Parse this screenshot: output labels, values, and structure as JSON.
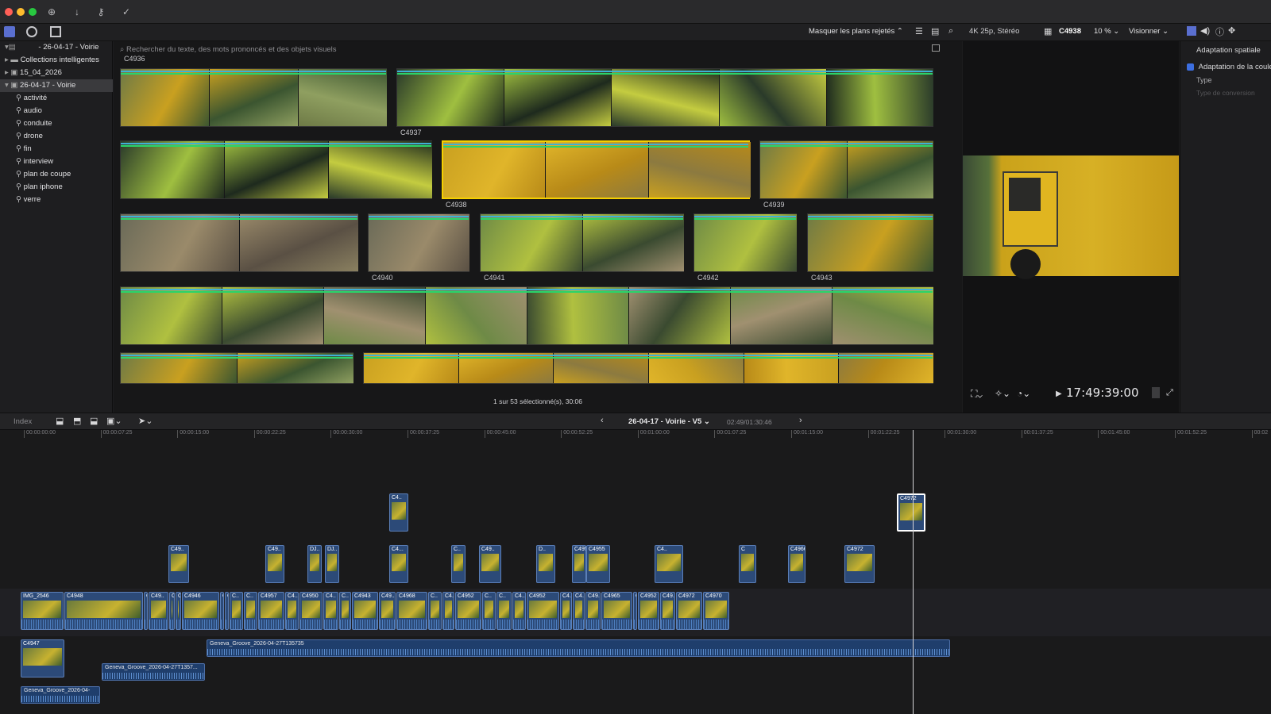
{
  "toolbar": {
    "library_title": "- 26-04-17 - Voirie",
    "hide_rejected": "Masquer les plans rejetés",
    "format": "4K 25p, Stéréo",
    "clip_name": "C4938",
    "zoom": "10 %",
    "view_menu": "Visionner"
  },
  "sidebar": {
    "items": [
      {
        "label": "Collections intelligentes"
      },
      {
        "label": "15_04_2026"
      },
      {
        "label": "26-04-17 - Voirie"
      }
    ],
    "keywords": [
      "activité",
      "audio",
      "conduite",
      "drone",
      "fin",
      "interview",
      "plan de coupe",
      "plan iphone",
      "verre"
    ]
  },
  "browser": {
    "search_placeholder": "Rechercher du texte, des mots prononcés et des objets visuels",
    "top_label": "C4936",
    "clip_labels": [
      "C4937",
      "C4938",
      "C4939",
      "C4940",
      "C4941",
      "C4942",
      "C4943"
    ],
    "status": "1 sur 53 sélectionné(s), 30:06"
  },
  "viewer": {
    "timecode": "17:49:39:00"
  },
  "inspector": {
    "title": "Adaptation spatiale",
    "checkbox_label": "Adaptation de la couleur",
    "type_label": "Type",
    "conversion_placeholder": "Type de conversion"
  },
  "timeline": {
    "index": "Index",
    "project": "26-04-17 - Voirie - V5",
    "duration": "02:49/01:30:46",
    "ruler": [
      "00:00:00:00",
      "00:00:07:25",
      "00:00:15:00",
      "00:00:22:25",
      "00:00:30:00",
      "00:00:37:25",
      "00:00:45:00",
      "00:00:52:25",
      "00:01:00:00",
      "00:01:07:25",
      "00:01:15:00",
      "00:01:22:25",
      "00:01:30:00",
      "00:01:37:25",
      "00:01:45:00",
      "00:01:52:25",
      "00:02"
    ],
    "primary_clips": [
      "IMG_2546",
      "C4948",
      "C",
      "C49..",
      "C",
      "C",
      "C4946",
      "C",
      "C",
      "C..",
      "C..",
      "C4957",
      "C4..",
      "C4950",
      "C4..",
      "C..",
      "C4943",
      "C49..",
      "C4968",
      "C..",
      "C4..",
      "C4952",
      "C..",
      "C..",
      "C4..",
      "C4952",
      "C4..",
      "C4..",
      "C49..",
      "C4965",
      "C",
      "C4952",
      "C49..",
      "C4972",
      "C4970"
    ],
    "connected_clips": [
      "C49..",
      "C49..",
      "DJ..",
      "DJ..",
      "C4..",
      "C4...",
      "C..",
      "C49..",
      "D..",
      "C4955",
      "C4955",
      "C4..",
      "C",
      "C4966",
      "C4972",
      "C4972"
    ],
    "audio_clips": [
      "Geneva_Groove_2026-04-27T135735",
      "Geneva_Groove_2026-04-27T1357...",
      "Geneva_Groove_2026-04-",
      "C4947"
    ]
  }
}
